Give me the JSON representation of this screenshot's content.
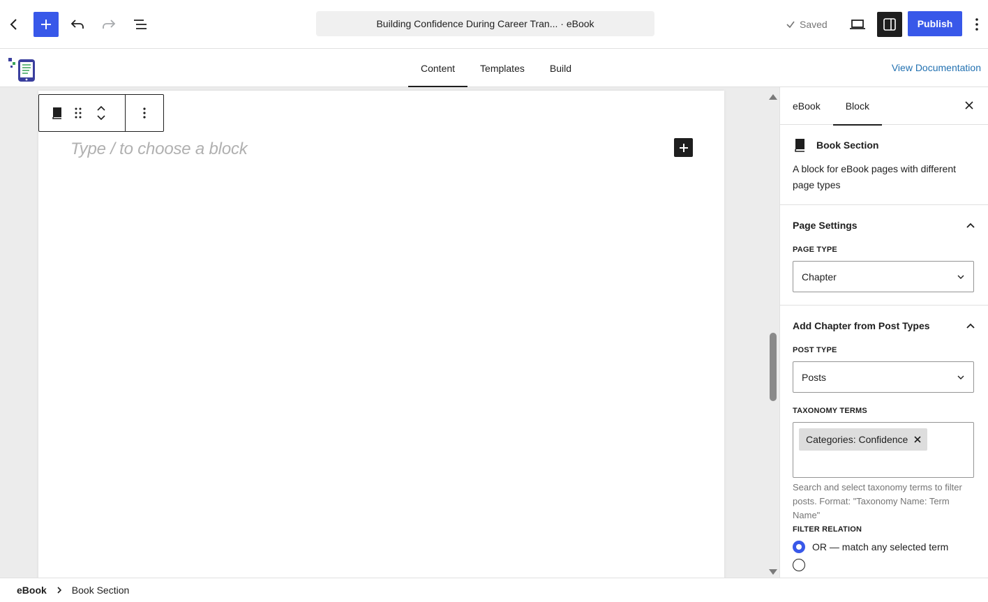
{
  "header": {
    "document_title": "Building Confidence During Career Tran... · eBook",
    "saved_label": "Saved",
    "publish_label": "Publish"
  },
  "subnav": {
    "tabs": [
      {
        "label": "Content",
        "active": true
      },
      {
        "label": "Templates",
        "active": false
      },
      {
        "label": "Build",
        "active": false
      }
    ],
    "docs_link": "View Documentation"
  },
  "editor": {
    "placeholder": "Type / to choose a block"
  },
  "sidebar": {
    "tabs": [
      {
        "label": "eBook",
        "active": false
      },
      {
        "label": "Block",
        "active": true
      }
    ],
    "block": {
      "title": "Book Section",
      "description": "A block for eBook pages with different page types"
    },
    "page_settings": {
      "title": "Page Settings",
      "page_type_label": "PAGE TYPE",
      "page_type_value": "Chapter"
    },
    "add_chapter": {
      "title": "Add Chapter from Post Types",
      "post_type_label": "POST TYPE",
      "post_type_value": "Posts",
      "taxonomy_label": "TAXONOMY TERMS",
      "token": "Categories: Confidence",
      "help": "Search and select taxonomy terms to filter posts. Format: \"Taxonomy Name: Term Name\"",
      "filter_label": "FILTER RELATION",
      "filter_option_or": "OR — match any selected term"
    }
  },
  "footer": {
    "root": "eBook",
    "current": "Book Section"
  },
  "colors": {
    "accent": "#3858e9",
    "dark": "#1e1e1e",
    "link": "#2271b1"
  }
}
